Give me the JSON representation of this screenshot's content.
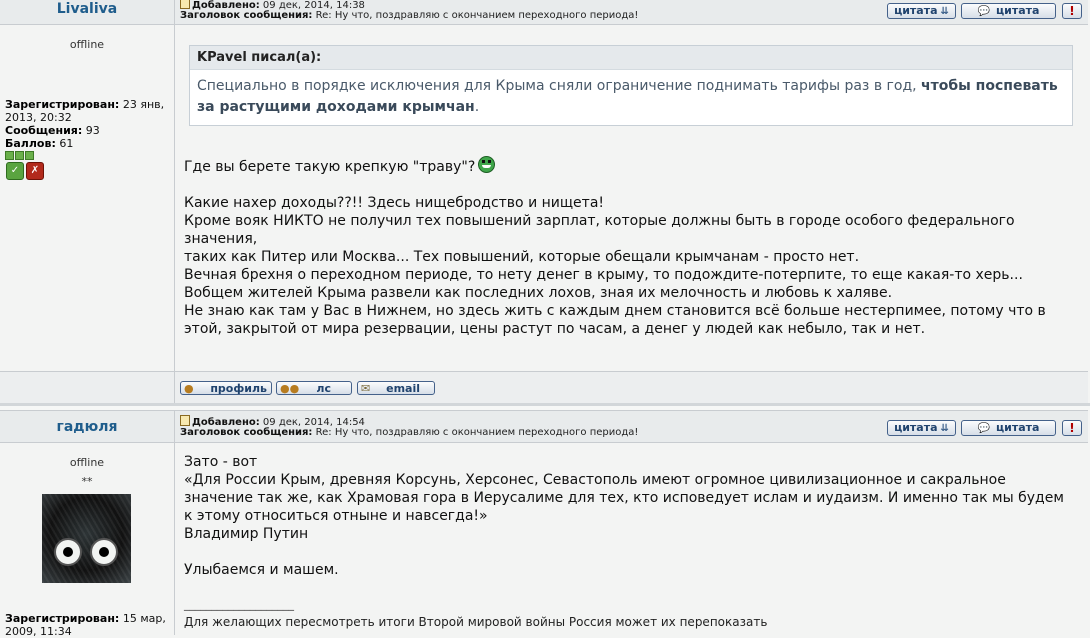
{
  "post1": {
    "author": "Livaliva",
    "added_label": "Добавлено:",
    "added_value": "09 дек, 2014, 14:38",
    "subject_label": "Заголовок сообщения:",
    "subject_value": "Re: Ну что, поздравляю с окончанием переходного периода!",
    "status": "offline",
    "registered_label": "Зарегистрирован:",
    "registered_value": "23 янв,",
    "registered_value2": "2013, 20:32",
    "messages_label": "Сообщения:",
    "messages_value": "93",
    "points_label": "Баллов:",
    "points_value": "61",
    "quote_author": "KPavel писал(а):",
    "quote_text": "Специально в порядке исключения для Крыма сняли ограничение поднимать тарифы раз в год,",
    "quote_bold": "чтобы поспевать за растущими доходами крымчан",
    "quote_end": ".",
    "line1": "Где вы берете такую крепкую \"траву\"?",
    "lines": [
      "Какие нахер доходы??!! Здесь нищебродство и нищета!",
      "Кроме вояк НИКТО не получил тех повышений зарплат, которые должны быть в городе особого федерального",
      "значения,",
      "таких как Питер или Москва... Тех повышений, которые обещали крымчанам - просто нет.",
      "Вечная брехня о переходном периоде, то нету денег в крыму, то подождите-потерпите, то еще какая-то херь...",
      "Вобщем жителей Крыма развели как последних лохов, зная их мелочность и любовь к халяве.",
      "Не знаю как там у Вас в Нижнем, но здесь жить с каждым днем становится всё больше нестерпимее, потому что в",
      "этой, закрытой от мира резервации, цены растут по часам, а денег у людей как небыло, так и нет."
    ]
  },
  "post2": {
    "author": "гадюля",
    "added_label": "Добавлено:",
    "added_value": "09 дек, 2014, 14:54",
    "subject_label": "Заголовок сообщения:",
    "subject_value": "Re: Ну что, поздравляю с окончанием переходного периода!",
    "status": "offline",
    "rank": "**",
    "registered_label": "Зарегистрирован:",
    "registered_value": "15 мар,",
    "registered_value2": "2009, 11:34",
    "lines": [
      "Зато - вот",
      "«Для России Крым, древняя Корсунь, Херсонес, Севастополь имеют огромное цивилизационное и сакральное",
      "значение так же, как Храмовая гора в Иерусалиме для тех, кто исповедует ислам и иудаизм. И именно так мы будем",
      "к этому относиться отныне и навсегда!»",
      "Владимир Путин",
      "",
      "Улыбаемся и машем."
    ],
    "sig_rule": "____________________",
    "sig_text": "Для желающих пересмотреть итоги Второй мировой войны Россия может их перепоказать"
  },
  "buttons": {
    "quote_selected": "цитата",
    "quote": "цитата",
    "report": "!",
    "profile": "профиль",
    "pm": "лс",
    "email": "email"
  },
  "icons": {
    "quote_selected": "double-chevron-down-icon",
    "quote": "speech-bubble-icon",
    "profile": "person-icon",
    "pm": "people-icon",
    "email": "envelope-icon",
    "post": "post-icon",
    "smiley": "grin-smiley-icon"
  },
  "colors": {
    "author": "#1f5d8c",
    "button_text": "#20436e",
    "report": "#b00000",
    "page_bg": "#f3f4f3",
    "header_bg": "#e8ebec"
  }
}
